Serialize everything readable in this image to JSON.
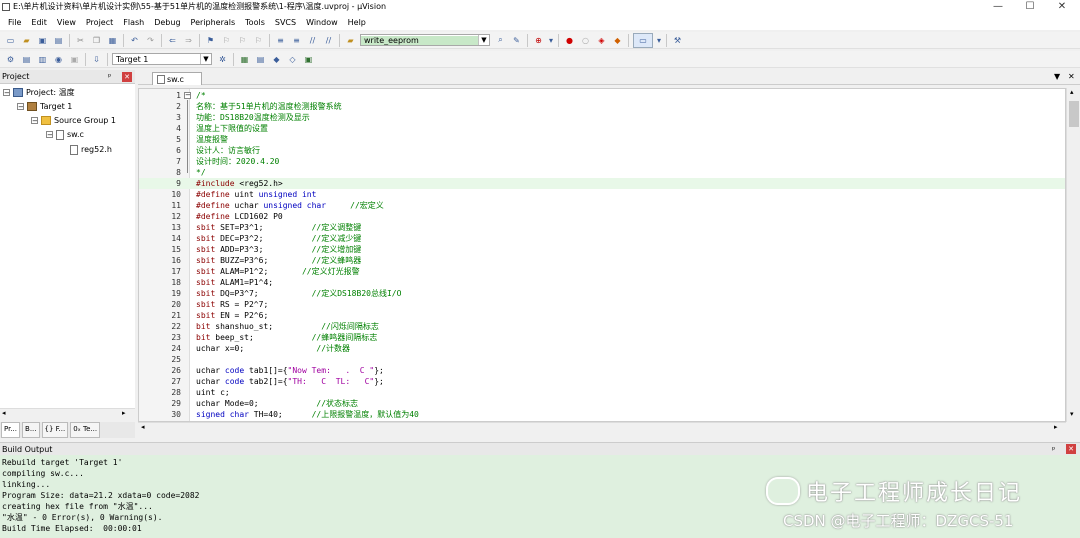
{
  "window": {
    "title": "E:\\单片机设计资料\\单片机设计实例\\55-基于51单片机的温度检测报警系统\\1-程序\\温度.uvproj - µVision",
    "minimize_glyph": "—",
    "maximize_glyph": "☐",
    "close_glyph": "✕"
  },
  "menu": [
    "File",
    "Edit",
    "View",
    "Project",
    "Flash",
    "Debug",
    "Peripherals",
    "Tools",
    "SVCS",
    "Window",
    "Help"
  ],
  "toolbar": {
    "find_combo_value": "write_eeprom",
    "target_combo_value": "Target 1"
  },
  "project_panel": {
    "title": "Project",
    "pin_glyph": "ᵖ",
    "close_glyph": "✕",
    "tree": {
      "project": "Project: 温度",
      "target": "Target 1",
      "group": "Source Group 1",
      "file": "sw.c",
      "header": "reg52.h"
    },
    "tabs": [
      "Pr...",
      "B...",
      "{} F...",
      "0ₓ Te..."
    ]
  },
  "editor": {
    "tab_label": "sw.c",
    "menu_glyph": "▼",
    "close_glyph": "✕",
    "lines": [
      {
        "n": "1",
        "segs": [
          {
            "t": "/*",
            "c": "cm"
          }
        ]
      },
      {
        "n": "2",
        "segs": [
          {
            "t": "名称：基于51单片机的温度检测报警系统",
            "c": "cm"
          }
        ]
      },
      {
        "n": "3",
        "segs": [
          {
            "t": "功能：DS18B20温度检测及显示",
            "c": "cm"
          }
        ]
      },
      {
        "n": "4",
        "segs": [
          {
            "t": "温度上下限值的设置",
            "c": "cm"
          }
        ]
      },
      {
        "n": "5",
        "segs": [
          {
            "t": "温度报警",
            "c": "cm"
          }
        ]
      },
      {
        "n": "6",
        "segs": [
          {
            "t": "设计人：访言敏行",
            "c": "cm"
          }
        ]
      },
      {
        "n": "7",
        "segs": [
          {
            "t": "设计时间：2020.4.20",
            "c": "cm"
          }
        ]
      },
      {
        "n": "8",
        "segs": [
          {
            "t": "*/",
            "c": "cm"
          }
        ]
      },
      {
        "n": "9",
        "segs": [
          {
            "t": "#include ",
            "c": "pp"
          },
          {
            "t": "<reg52.h>",
            "c": "df"
          }
        ],
        "hl": true
      },
      {
        "n": "10",
        "segs": [
          {
            "t": "#define ",
            "c": "pp"
          },
          {
            "t": "uint ",
            "c": "df"
          },
          {
            "t": "unsigned int",
            "c": "kw"
          }
        ]
      },
      {
        "n": "11",
        "segs": [
          {
            "t": "#define ",
            "c": "pp"
          },
          {
            "t": "uchar ",
            "c": "df"
          },
          {
            "t": "unsigned char",
            "c": "kw"
          },
          {
            "t": "     //宏定义",
            "c": "cm"
          }
        ]
      },
      {
        "n": "12",
        "segs": [
          {
            "t": "#define ",
            "c": "pp"
          },
          {
            "t": "LCD1602 P0",
            "c": "df"
          }
        ]
      },
      {
        "n": "13",
        "segs": [
          {
            "t": "sbit ",
            "c": "pp"
          },
          {
            "t": "SET=P3^1;",
            "c": "df"
          },
          {
            "t": "          //定义调整键",
            "c": "cm"
          }
        ]
      },
      {
        "n": "14",
        "segs": [
          {
            "t": "sbit ",
            "c": "pp"
          },
          {
            "t": "DEC=P3^2;",
            "c": "df"
          },
          {
            "t": "          //定义减少键",
            "c": "cm"
          }
        ]
      },
      {
        "n": "15",
        "segs": [
          {
            "t": "sbit ",
            "c": "pp"
          },
          {
            "t": "ADD=P3^3;",
            "c": "df"
          },
          {
            "t": "          //定义增加键",
            "c": "cm"
          }
        ]
      },
      {
        "n": "16",
        "segs": [
          {
            "t": "sbit ",
            "c": "pp"
          },
          {
            "t": "BUZZ=P3^6;",
            "c": "df"
          },
          {
            "t": "         //定义蜂鸣器",
            "c": "cm"
          }
        ]
      },
      {
        "n": "17",
        "segs": [
          {
            "t": "sbit ",
            "c": "pp"
          },
          {
            "t": "ALAM=P1^2;",
            "c": "df"
          },
          {
            "t": "       //定义灯光报警",
            "c": "cm"
          }
        ]
      },
      {
        "n": "18",
        "segs": [
          {
            "t": "sbit ",
            "c": "pp"
          },
          {
            "t": "ALAM1=P1^4;",
            "c": "df"
          }
        ]
      },
      {
        "n": "19",
        "segs": [
          {
            "t": "sbit ",
            "c": "pp"
          },
          {
            "t": "DQ=P3^7;",
            "c": "df"
          },
          {
            "t": "           //定义DS18B20总线I/O",
            "c": "cm"
          }
        ]
      },
      {
        "n": "20",
        "segs": [
          {
            "t": "sbit ",
            "c": "pp"
          },
          {
            "t": "RS = P2^7;",
            "c": "df"
          }
        ]
      },
      {
        "n": "21",
        "segs": [
          {
            "t": "sbit ",
            "c": "pp"
          },
          {
            "t": "EN = P2^6;",
            "c": "df"
          }
        ]
      },
      {
        "n": "22",
        "segs": [
          {
            "t": "bit ",
            "c": "pp"
          },
          {
            "t": "shanshuo_st;",
            "c": "df"
          },
          {
            "t": "          //闪烁间隔标志",
            "c": "cm"
          }
        ]
      },
      {
        "n": "23",
        "segs": [
          {
            "t": "bit ",
            "c": "pp"
          },
          {
            "t": "beep_st;",
            "c": "df"
          },
          {
            "t": "            //蜂鸣器间隔标志",
            "c": "cm"
          }
        ]
      },
      {
        "n": "24",
        "segs": [
          {
            "t": "uchar ",
            "c": "df"
          },
          {
            "t": "x=0;",
            "c": "df"
          },
          {
            "t": "               //计数器",
            "c": "cm"
          }
        ]
      },
      {
        "n": "25",
        "segs": []
      },
      {
        "n": "26",
        "segs": [
          {
            "t": "uchar ",
            "c": "df"
          },
          {
            "t": "code ",
            "c": "kw"
          },
          {
            "t": "tab1[]={",
            "c": "df"
          },
          {
            "t": "\"Now Tem:   .  C \"",
            "c": "st"
          },
          {
            "t": "};",
            "c": "df"
          }
        ]
      },
      {
        "n": "27",
        "segs": [
          {
            "t": "uchar ",
            "c": "df"
          },
          {
            "t": "code ",
            "c": "kw"
          },
          {
            "t": "tab2[]={",
            "c": "df"
          },
          {
            "t": "\"TH:   C  TL:   C\"",
            "c": "st"
          },
          {
            "t": "};",
            "c": "df"
          }
        ]
      },
      {
        "n": "28",
        "segs": [
          {
            "t": "uint c;",
            "c": "df"
          }
        ]
      },
      {
        "n": "29",
        "segs": [
          {
            "t": "uchar ",
            "c": "df"
          },
          {
            "t": "Mode=0;",
            "c": "df"
          },
          {
            "t": "            //状态标志",
            "c": "cm"
          }
        ]
      },
      {
        "n": "30",
        "segs": [
          {
            "t": "signed char ",
            "c": "kw"
          },
          {
            "t": "TH=40;",
            "c": "df"
          },
          {
            "t": "      //上限报警温度，默认值为40",
            "c": "cm"
          }
        ]
      }
    ]
  },
  "build_output": {
    "title": "Build Output",
    "pin_glyph": "ᵖ",
    "close_glyph": "✕",
    "lines": [
      "Rebuild target 'Target 1'",
      "compiling sw.c...",
      "linking...",
      "Program Size: data=21.2 xdata=0 code=2082",
      "creating hex file from \"水温\"...",
      "\"水温\" - 0 Error(s), 0 Warning(s).",
      "Build Time Elapsed:  00:00:01"
    ]
  },
  "watermark": {
    "line1": "电子工程师成长日记",
    "line2": "CSDN @电子工程师：DZGCS-51"
  },
  "colors": {
    "comment": "#008000",
    "preprocessor": "#8b0000",
    "keyword": "#0000c0",
    "string": "#a000a0",
    "project_tree_bg": "#ffffff",
    "build_output_bg": "#dff0df",
    "highlight_line": "#e8f8e8"
  }
}
